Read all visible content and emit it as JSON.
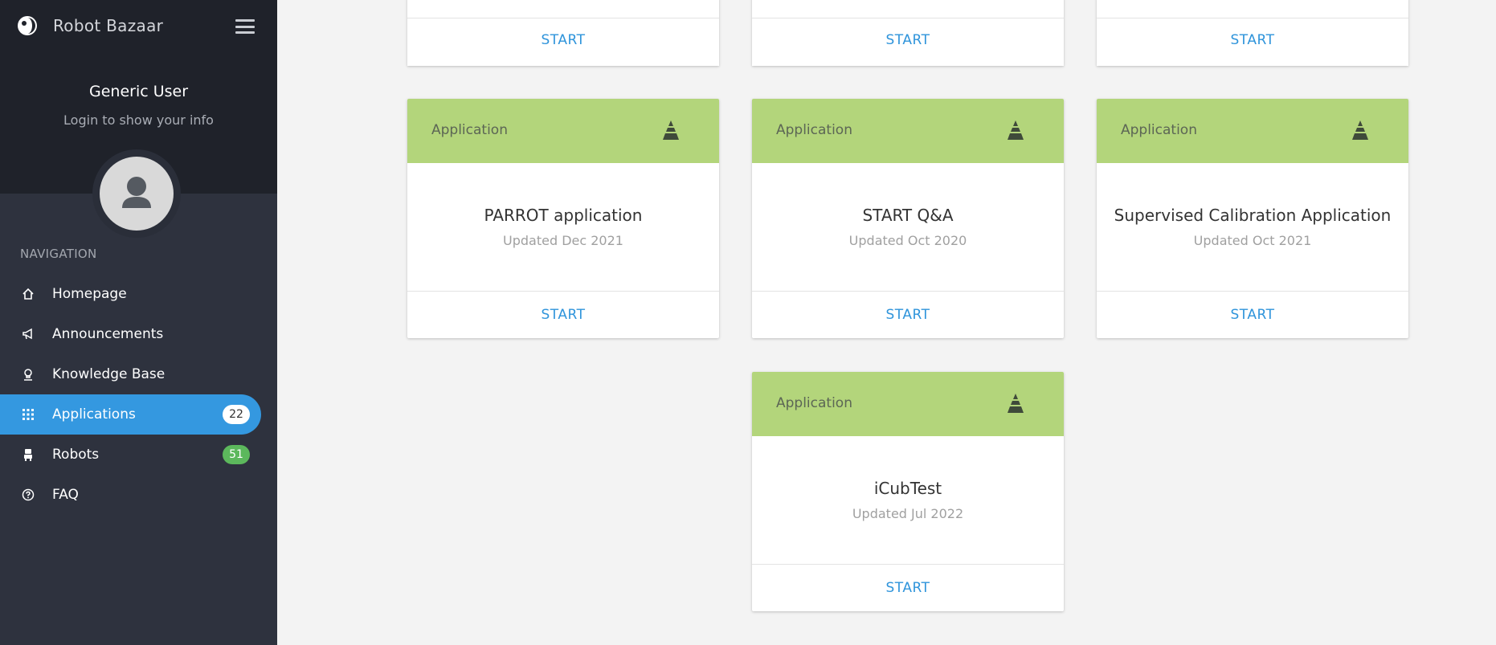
{
  "app": {
    "name": "Robot Bazaar"
  },
  "user": {
    "name": "Generic User",
    "subtitle": "Login to show your info"
  },
  "nav": {
    "heading": "NAVIGATION",
    "items": [
      {
        "label": "Homepage",
        "icon": "home-icon"
      },
      {
        "label": "Announcements",
        "icon": "megaphone-icon"
      },
      {
        "label": "Knowledge Base",
        "icon": "lightbulb-icon"
      },
      {
        "label": "Applications",
        "icon": "grid-icon",
        "badge": "22",
        "active": true
      },
      {
        "label": "Robots",
        "icon": "robot-icon",
        "badge": "51"
      },
      {
        "label": "FAQ",
        "icon": "question-icon"
      }
    ]
  },
  "top_cards": {
    "start_label": "START"
  },
  "cards": [
    {
      "type": "Application",
      "title": "PARROT application",
      "updated": "Updated Dec 2021",
      "action": "START"
    },
    {
      "type": "Application",
      "title": "START Q&A",
      "updated": "Updated Oct 2020",
      "action": "START"
    },
    {
      "type": "Application",
      "title": "Supervised Calibration Application",
      "updated": "Updated Oct 2021",
      "action": "START"
    },
    {
      "type": "Application",
      "title": "iCubTest",
      "updated": "Updated Jul 2022",
      "action": "START"
    }
  ],
  "colors": {
    "sidebar": "#2e323e",
    "sidebar_top": "#1f222a",
    "accent": "#3498e0",
    "card_header": "#b3d57b",
    "link": "#2f94db",
    "badge_green": "#5cb85c"
  }
}
